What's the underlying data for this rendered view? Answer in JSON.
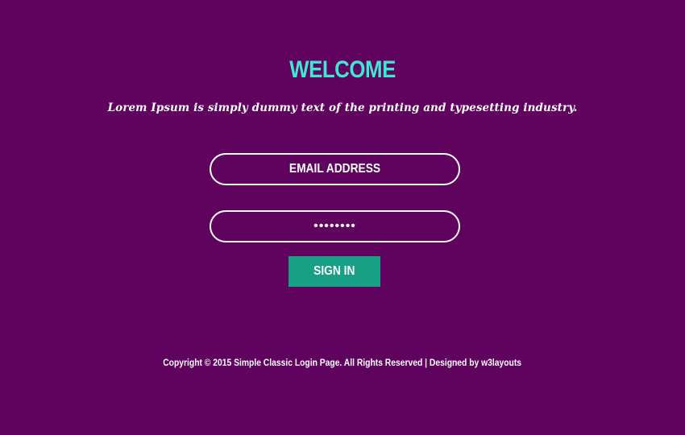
{
  "colors": {
    "background": "#5f035f",
    "heading": "#3fe6d2",
    "button": "#17a086",
    "text": "#ffffff"
  },
  "header": {
    "title": "WELCOME",
    "tagline": "Lorem Ipsum is simply dummy text of the printing and typesetting industry."
  },
  "form": {
    "email_value": "EMAIL ADDRESS",
    "password_mask": "••••••••",
    "submit_label": "SIGN IN"
  },
  "footer": {
    "text": "Copyright © 2015 Simple Classic Login Page. All Rights Reserved | Designed by w3layouts"
  }
}
